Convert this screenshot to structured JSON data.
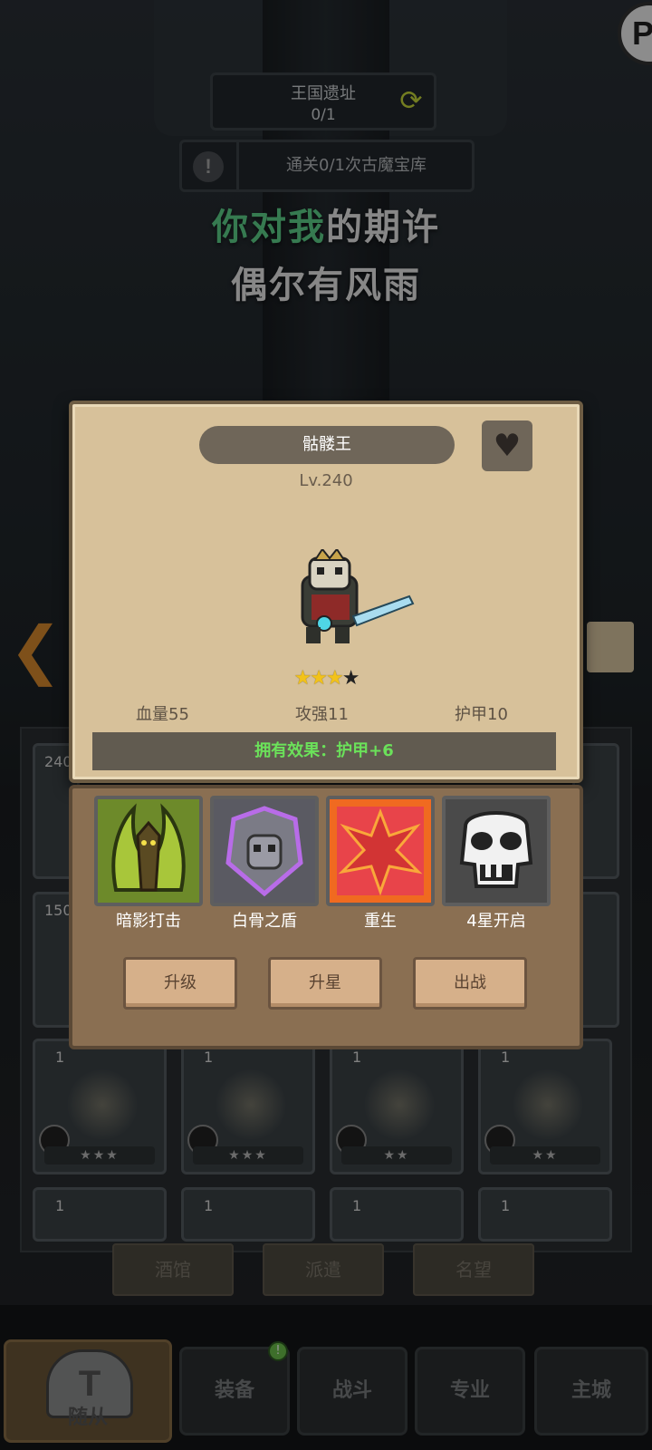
{
  "hud": {
    "round_btn_letter": "P",
    "stage_name": "王国遗址",
    "stage_progress": "0/1",
    "quest_text": "通关0/1次古魔宝库"
  },
  "lyrics": {
    "line1_highlight": "你对我",
    "line1_rest": "的期许",
    "line2": "偶尔有风雨"
  },
  "hero": {
    "name": "骷髅王",
    "level": "Lv.240",
    "stars_filled": 3,
    "stars_total": 4,
    "stats": {
      "hp": "血量55",
      "attack": "攻强11",
      "armor": "护甲10"
    },
    "owned_effect": "拥有效果：护甲+6"
  },
  "skills": [
    {
      "label": "暗影打击",
      "icon": "shadow-strike-icon"
    },
    {
      "label": "白骨之盾",
      "icon": "bone-shield-icon"
    },
    {
      "label": "重生",
      "icon": "rebirth-icon"
    },
    {
      "label": "4星开启",
      "icon": "locked-skull-icon"
    }
  ],
  "actions": {
    "upgrade": "升级",
    "star_up": "升星",
    "deploy": "出战"
  },
  "roster": {
    "partial_levels": [
      "240",
      "150"
    ],
    "row_levels": [
      "1",
      "1",
      "1",
      "1"
    ],
    "row_stars": [
      "★★★",
      "★★★",
      "★★",
      "★★"
    ],
    "bottom_levels": [
      "1",
      "1",
      "1",
      "1"
    ]
  },
  "sub_tabs": [
    "酒馆",
    "派遣",
    "名望"
  ],
  "nav": {
    "followers": "随从",
    "equipment": "装备",
    "battle": "战斗",
    "profession": "专业",
    "main_city": "主城",
    "equipment_badge": "!"
  },
  "colors": {
    "highlight_green": "#5ed28b",
    "effect_green": "#6be15a",
    "star_gold": "#f2c21a"
  }
}
